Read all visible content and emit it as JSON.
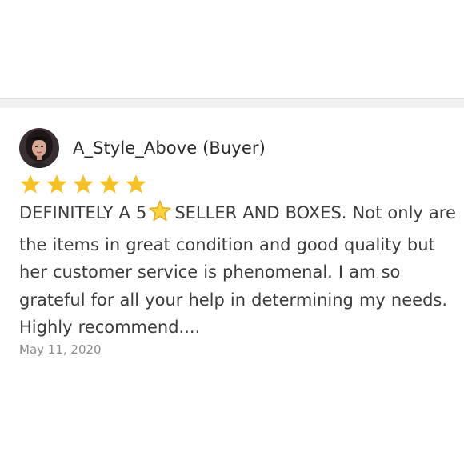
{
  "review": {
    "reviewer": "A_Style_Above (Buyer)",
    "rating": 5,
    "rating_max": 5,
    "star_color": "#f5c226",
    "inline_star_icon": "star-emoji-icon",
    "text_before_star": "DEFINITELY A 5",
    "text_after_star": "SELLER AND BOXES. Not only are the items in great condition and good quality but her customer service is phenomenal. I am so grateful for all your help in determining my needs. Highly recommend....",
    "date": "May 11, 2020"
  }
}
